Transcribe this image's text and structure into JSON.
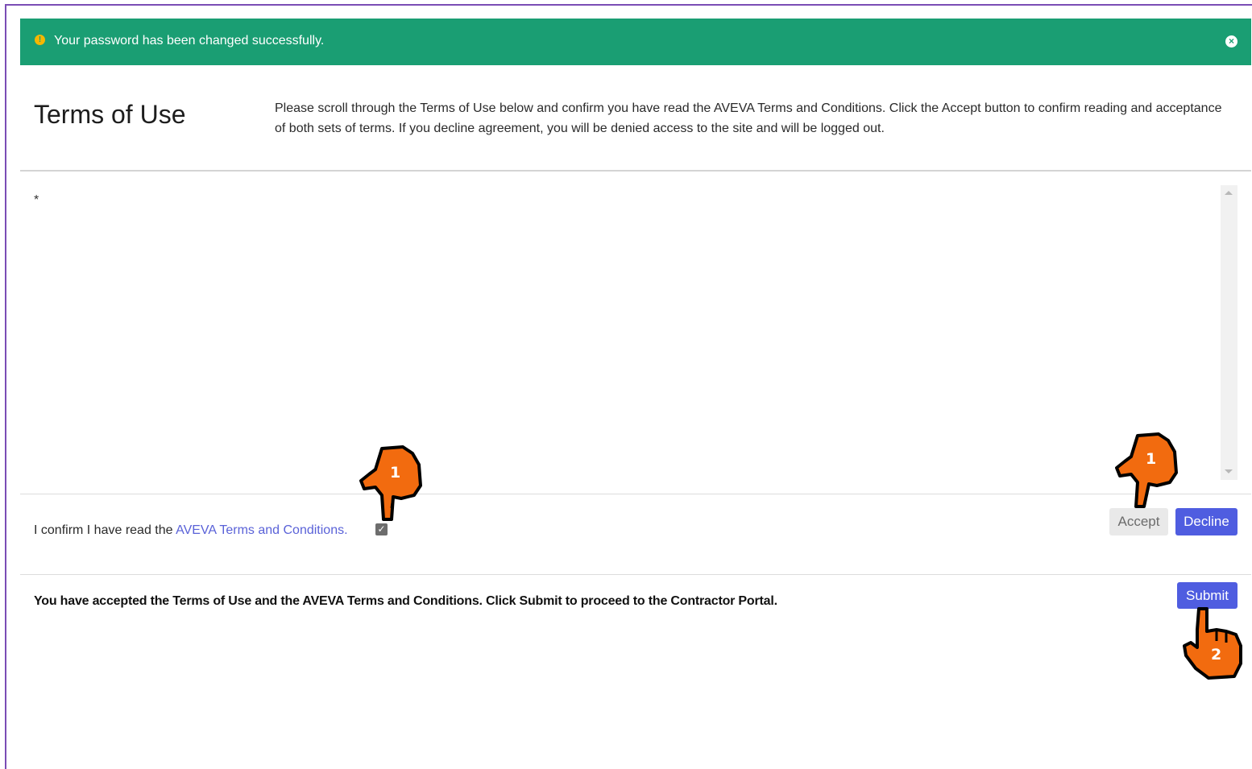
{
  "alert": {
    "message": "Your password has been changed successfully.",
    "icon": "info-icon",
    "close_icon": "close-circle-icon",
    "color": "#1a9e73"
  },
  "header": {
    "title": "Terms of Use",
    "intro": "Please scroll through the Terms of Use below and confirm you have read the AVEVA Terms and Conditions. Click the Accept button to confirm reading and acceptance of both sets of terms. If you decline agreement, you will be denied access to the site and will be logged out."
  },
  "terms": {
    "content": "*"
  },
  "confirm": {
    "prefix": "I confirm I have read the ",
    "link_text": "AVEVA Terms and Conditions.",
    "checked": true
  },
  "actions": {
    "accept_label": "Accept",
    "decline_label": "Decline",
    "submit_label": "Submit"
  },
  "accepted_message": "You have accepted the Terms of Use and the AVEVA Terms and Conditions. Click Submit to proceed to the Contractor Portal.",
  "annotations": {
    "checkbox_step": "1",
    "accept_step": "1",
    "submit_step": "2",
    "hand_color": "#f26b0f"
  },
  "colors": {
    "primary_button": "#4f5de0",
    "link": "#5a62d8"
  }
}
